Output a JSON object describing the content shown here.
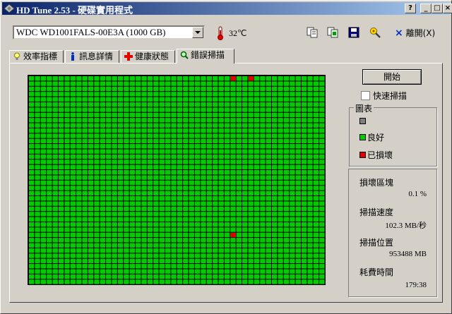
{
  "window": {
    "title": "HD Tune 2.53 - 硬碟實用程式",
    "controls": {
      "help": "?",
      "minimize": "_",
      "maximize": "□",
      "close": "×"
    }
  },
  "toolbar": {
    "drive": "WDC WD1001FALS-00E3A (1000 GB)",
    "temperature": "32℃",
    "icons": [
      "copy-text-icon",
      "copy-info-icon",
      "save-icon",
      "options-icon"
    ],
    "exit_key": "×",
    "exit_label": "離開(X)"
  },
  "tabs": [
    {
      "label": "效率指標",
      "icon": "benchmark-icon"
    },
    {
      "label": "訊息詳情",
      "icon": "info-icon"
    },
    {
      "label": "健康狀態",
      "icon": "health-icon"
    },
    {
      "label": "錯誤掃描",
      "icon": "search-icon",
      "active": true
    }
  ],
  "scan": {
    "grid_cols": 50,
    "grid_rows": 40,
    "bad_blocks": [
      {
        "col": 34,
        "row": 0
      },
      {
        "col": 37,
        "row": 0
      },
      {
        "col": 34,
        "row": 30
      }
    ],
    "start_label": "開始",
    "quick_scan_label": "快速掃描",
    "quick_scan_checked": false
  },
  "legend": {
    "caption": "圖表",
    "items": [
      {
        "label": "",
        "color": "#808080"
      },
      {
        "label": "良好",
        "color": "#00cc00"
      },
      {
        "label": "已損壞",
        "color": "#e00000"
      }
    ]
  },
  "stats": {
    "damaged_label": "損壞區塊",
    "damaged_value": "0.1 %",
    "speed_label": "掃描速度",
    "speed_value": "102.3 MB/秒",
    "position_label": "掃描位置",
    "position_value": "953488 MB",
    "time_label": "耗費時間",
    "time_value": "179:38"
  }
}
